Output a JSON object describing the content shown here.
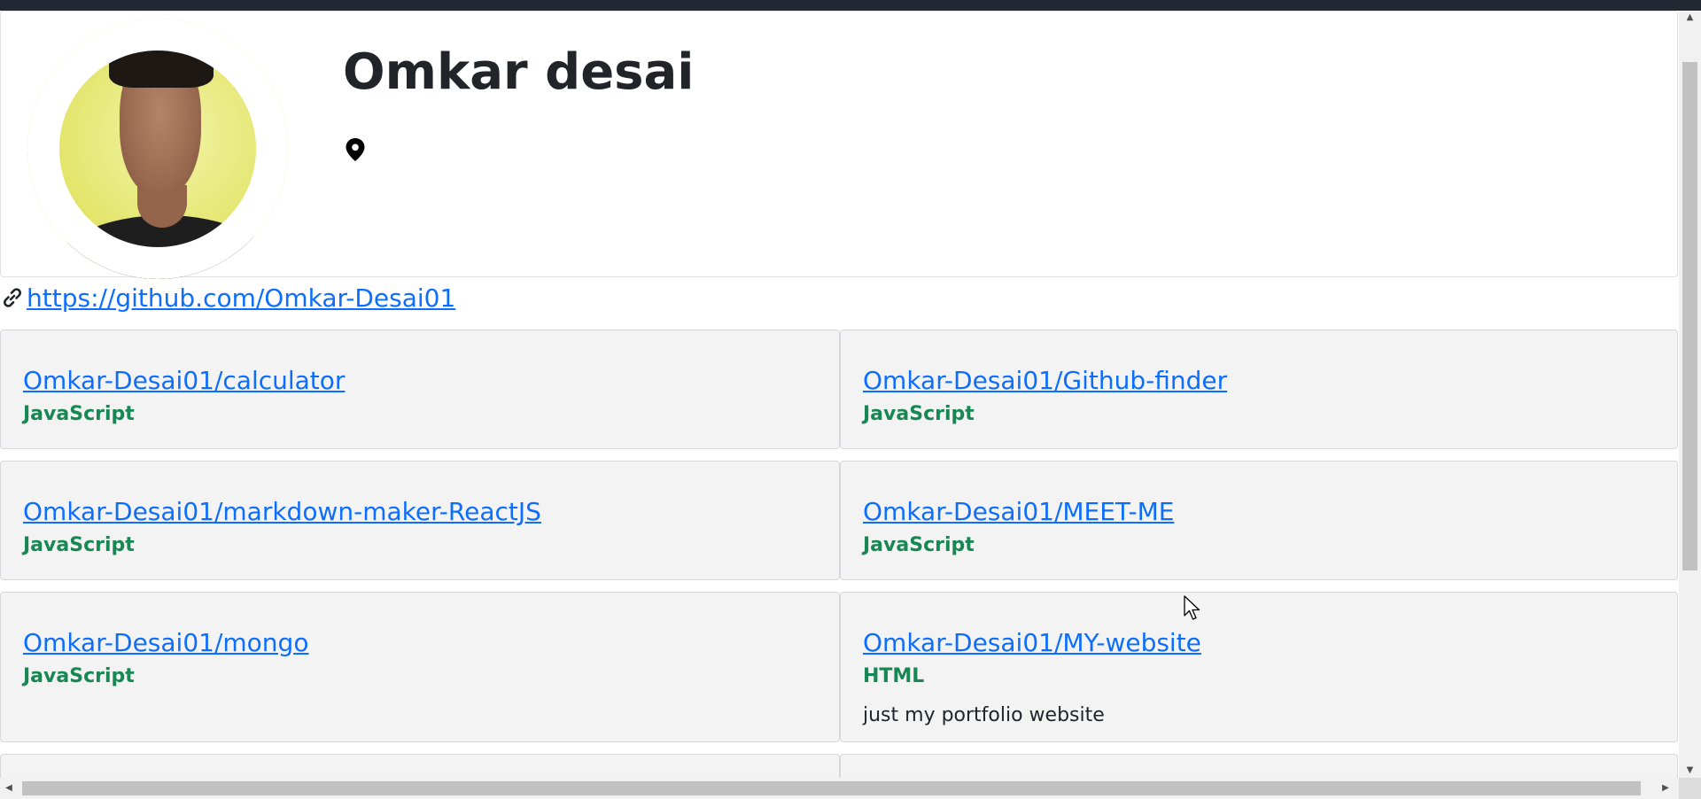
{
  "profile": {
    "name": "Omkar desai",
    "link": "https://github.com/Omkar-Desai01",
    "link_icon": "link-icon",
    "location_icon": "location-pin-icon"
  },
  "repos": [
    {
      "name": "Omkar-Desai01/calculator",
      "language": "JavaScript",
      "description": ""
    },
    {
      "name": "Omkar-Desai01/Github-finder",
      "language": "JavaScript",
      "description": ""
    },
    {
      "name": "Omkar-Desai01/markdown-maker-ReactJS",
      "language": "JavaScript",
      "description": ""
    },
    {
      "name": "Omkar-Desai01/MEET-ME",
      "language": "JavaScript",
      "description": ""
    },
    {
      "name": "Omkar-Desai01/mongo",
      "language": "JavaScript",
      "description": ""
    },
    {
      "name": "Omkar-Desai01/MY-website",
      "language": "HTML",
      "description": "just my portfolio website"
    }
  ],
  "colors": {
    "link": "#0d6efd",
    "language": "#198754",
    "card_bg": "#f3f3f3",
    "topbar": "#222831"
  }
}
